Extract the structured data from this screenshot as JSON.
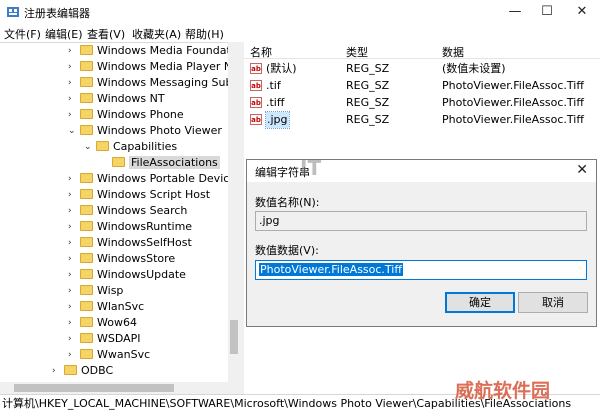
{
  "window": {
    "title": "注册表编辑器",
    "minimize": "—",
    "maximize": "☐",
    "close": "✕"
  },
  "menu": [
    "文件(F)",
    "编辑(E)",
    "查看(V)",
    "收藏夹(A)",
    "帮助(H)"
  ],
  "tree": [
    {
      "label": "Windows Media Foundation",
      "expander": "›"
    },
    {
      "label": "Windows Media Player NSS",
      "expander": "›"
    },
    {
      "label": "Windows Messaging Subsys",
      "expander": "›"
    },
    {
      "label": "Windows NT",
      "expander": "›"
    },
    {
      "label": "Windows Phone",
      "expander": "›"
    },
    {
      "label": "Windows Photo Viewer",
      "expander": "⌄"
    },
    {
      "label": "Capabilities",
      "expander": "⌄"
    },
    {
      "label": "FileAssociations",
      "expander": ""
    },
    {
      "label": "Windows Portable Devices",
      "expander": "›"
    },
    {
      "label": "Windows Script Host",
      "expander": "›"
    },
    {
      "label": "Windows Search",
      "expander": "›"
    },
    {
      "label": "WindowsRuntime",
      "expander": "›"
    },
    {
      "label": "WindowsSelfHost",
      "expander": "›"
    },
    {
      "label": "WindowsStore",
      "expander": "›"
    },
    {
      "label": "WindowsUpdate",
      "expander": "›"
    },
    {
      "label": "Wisp",
      "expander": "›"
    },
    {
      "label": "WlanSvc",
      "expander": "›"
    },
    {
      "label": "Wow64",
      "expander": "›"
    },
    {
      "label": "WSDAPI",
      "expander": "›"
    },
    {
      "label": "WwanSvc",
      "expander": "›"
    },
    {
      "label": "ODBC",
      "expander": "›"
    }
  ],
  "values_pane": {
    "headers": {
      "name": "名称",
      "type": "类型",
      "data": "数据"
    },
    "icon_text": "ab",
    "rows": [
      {
        "name": "(默认)",
        "type": "REG_SZ",
        "data": "(数值未设置)"
      },
      {
        "name": ".tif",
        "type": "REG_SZ",
        "data": "PhotoViewer.FileAssoc.Tiff"
      },
      {
        "name": ".tiff",
        "type": "REG_SZ",
        "data": "PhotoViewer.FileAssoc.Tiff"
      },
      {
        "name": ".jpg",
        "type": "REG_SZ",
        "data": "PhotoViewer.FileAssoc.Tiff"
      }
    ]
  },
  "dialog": {
    "title": "编辑字符串",
    "close": "✕",
    "name_label": "数值名称(N):",
    "name_value": ".jpg",
    "data_label": "数值数据(V):",
    "data_value": "PhotoViewer.FileAssoc.Tiff",
    "ok": "确定",
    "cancel": "取消"
  },
  "statusbar": "计算机\\HKEY_LOCAL_MACHINE\\SOFTWARE\\Microsoft\\Windows Photo Viewer\\Capabilities\\FileAssociations",
  "watermarks": {
    "logo": "IT",
    "site": "威航软件园"
  },
  "colors": {
    "selection": "#0078d7",
    "folder": "#f6d365",
    "watermark_site": "#d5573b"
  }
}
